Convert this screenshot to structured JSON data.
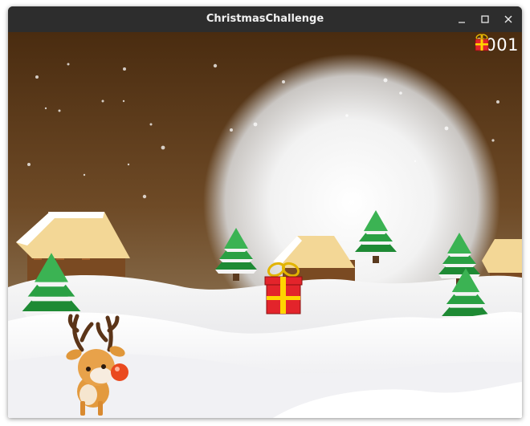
{
  "window": {
    "title": "ChristmasChallenge",
    "controls": [
      "minimize-icon",
      "maximize-icon",
      "close-icon"
    ]
  },
  "hud": {
    "score_icon": "gift-icon",
    "score": "0001"
  },
  "scene": {
    "sprites": [
      "reindeer",
      "gift-box"
    ],
    "colors": {
      "sky_top": "#4a2c10",
      "sky_glow": "#d8d8d8",
      "snow": "#f4f4f4",
      "tree": "#1f8a34",
      "gift_red": "#e3242b",
      "gift_ribbon": "#ffd400"
    }
  }
}
